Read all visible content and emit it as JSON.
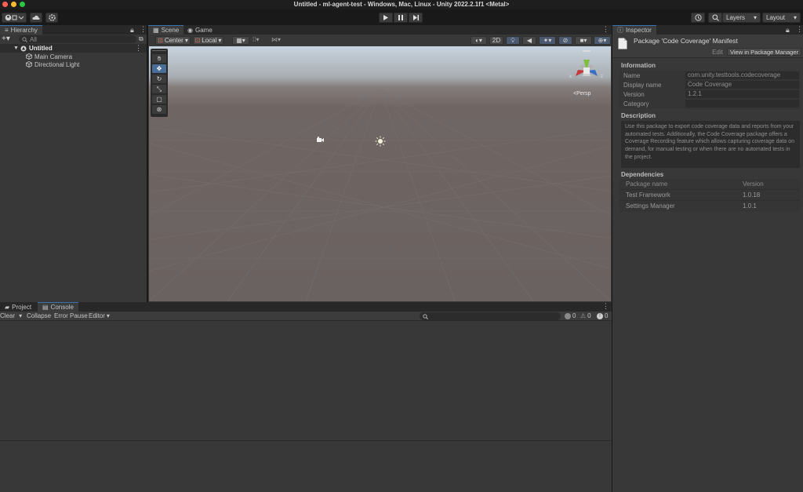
{
  "window": {
    "title": "Untitled - ml-agent-test - Windows, Mac, Linux - Unity 2022.2.1f1 <Metal>"
  },
  "toolbar": {
    "layers_label": "Layers",
    "layout_label": "Layout"
  },
  "hierarchy": {
    "tab_label": "Hierarchy",
    "search_placeholder": "All",
    "scene_name": "Untitled",
    "items": [
      {
        "label": "Main Camera"
      },
      {
        "label": "Directional Light"
      }
    ]
  },
  "scene_view": {
    "tabs": [
      {
        "label": "Scene"
      },
      {
        "label": "Game"
      }
    ],
    "pivot_label": "Center",
    "space_label": "Local",
    "mode_2d_label": "2D",
    "persp_label": "Persp",
    "gizmo_axes": [
      "x",
      "z"
    ]
  },
  "inspector": {
    "tab_label": "Inspector",
    "title": "Package 'Code Coverage' Manifest",
    "edit_label": "Edit",
    "view_in_pm_label": "View in Package Manager",
    "information_header": "Information",
    "fields": [
      {
        "label": "Name",
        "value": "com.unity.testtools.codecoverage"
      },
      {
        "label": "Display name",
        "value": "Code Coverage"
      },
      {
        "label": "Version",
        "value": "1.2.1"
      },
      {
        "label": "Category",
        "value": ""
      }
    ],
    "description_header": "Description",
    "description_text": "Use this package to export code coverage data and reports from your automated tests. Additionally, the Code Coverage package offers a Coverage Recording feature which allows capturing coverage data on demand, for manual testing or when there are no automated tests in the project.",
    "dependencies_header": "Dependencies",
    "dep_col_name": "Package name",
    "dep_col_version": "Version",
    "dependencies": [
      {
        "name": "Test Framework",
        "version": "1.0.18"
      },
      {
        "name": "Settings Manager",
        "version": "1.0.1"
      }
    ]
  },
  "console": {
    "tabs": [
      {
        "label": "Project"
      },
      {
        "label": "Console"
      }
    ],
    "clear_label": "Clear",
    "collapse_label": "Collapse",
    "error_pause_label": "Error Pause",
    "editor_label": "Editor",
    "counts": {
      "messages": "0",
      "warnings": "0",
      "errors": "0"
    }
  },
  "colors": {
    "accent": "#3a72b0",
    "panel": "#383838",
    "sky_top": "#c9d6e0",
    "ground": "#6e6563"
  }
}
